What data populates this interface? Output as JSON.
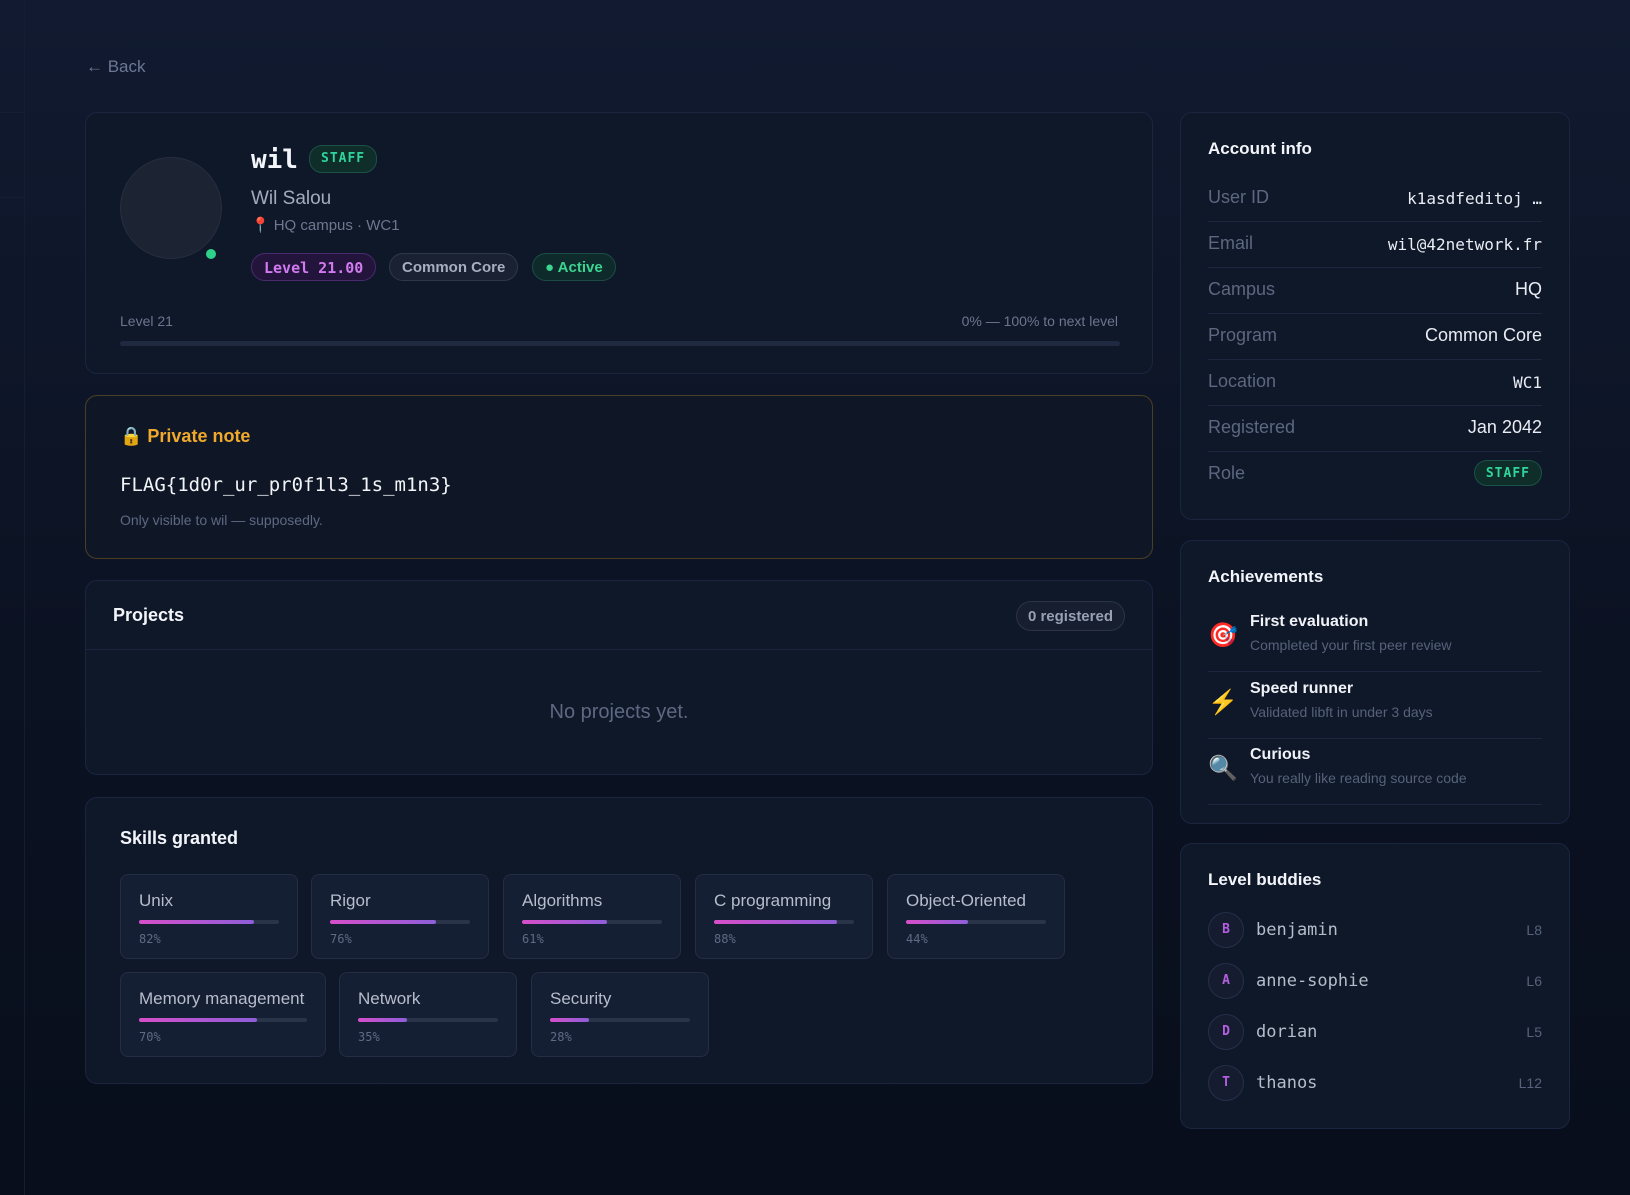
{
  "nav": {
    "back_label": "← Back"
  },
  "profile": {
    "login": "wil",
    "staff_badge": "STAFF",
    "full_name": "Wil Salou",
    "location_icon": "pin-icon",
    "location": "HQ campus · WC1",
    "level_pill": "Level 21.00",
    "program_pill": "Common Core",
    "status_pill": "● Active",
    "level_label": "Level 21",
    "level_progress_text": "0% — 100% to next level",
    "level_progress": 0
  },
  "private_note": {
    "icon": "lock-icon",
    "title": "🔒 Private note",
    "content": "FLAG{1d0r_ur_pr0f1l3_1s_m1n3}",
    "hint": "Only visible to wil — supposedly."
  },
  "projects": {
    "title": "Projects",
    "count_badge": "0 registered",
    "empty_text": "No projects yet."
  },
  "skills": {
    "title": "Skills granted",
    "items": [
      {
        "name": "Unix",
        "percent": 82,
        "percent_label": "82%"
      },
      {
        "name": "Rigor",
        "percent": 76,
        "percent_label": "76%"
      },
      {
        "name": "Algorithms",
        "percent": 61,
        "percent_label": "61%"
      },
      {
        "name": "C programming",
        "percent": 88,
        "percent_label": "88%"
      },
      {
        "name": "Object-Oriented",
        "percent": 44,
        "percent_label": "44%"
      },
      {
        "name": "Memory management",
        "percent": 70,
        "percent_label": "70%"
      },
      {
        "name": "Network",
        "percent": 35,
        "percent_label": "35%"
      },
      {
        "name": "Security",
        "percent": 28,
        "percent_label": "28%"
      }
    ]
  },
  "account": {
    "title": "Account info",
    "rows": [
      {
        "key": "User ID",
        "value": "k1asdfeditoj …"
      },
      {
        "key": "Email",
        "value": "wil@42network.fr"
      },
      {
        "key": "Campus",
        "value": "HQ"
      },
      {
        "key": "Program",
        "value": "Common Core"
      },
      {
        "key": "Location",
        "value": "WC1"
      },
      {
        "key": "Registered",
        "value": "Jan 2042"
      },
      {
        "key": "Role",
        "value": "STAFF"
      }
    ]
  },
  "achievements": {
    "title": "Achievements",
    "items": [
      {
        "icon": "🎯",
        "icon_name": "target-icon",
        "name": "First evaluation",
        "desc": "Completed your first peer review"
      },
      {
        "icon": "⚡",
        "icon_name": "lightning-icon",
        "name": "Speed runner",
        "desc": "Validated libft in under 3 days"
      },
      {
        "icon": "🔍",
        "icon_name": "magnifier-icon",
        "name": "Curious",
        "desc": "You really like reading source code"
      }
    ]
  },
  "buddies": {
    "title": "Level buddies",
    "items": [
      {
        "initial": "B",
        "login": "benjamin",
        "level": "L8"
      },
      {
        "initial": "A",
        "login": "anne-sophie",
        "level": "L6"
      },
      {
        "initial": "D",
        "login": "dorian",
        "level": "L5"
      },
      {
        "initial": "T",
        "login": "thanos",
        "level": "L12"
      }
    ]
  },
  "colors": {
    "accent_purple": "#c74fd9",
    "staff_green": "#30d59b",
    "note_orange": "#f0a92b",
    "background": "#0b1222"
  }
}
